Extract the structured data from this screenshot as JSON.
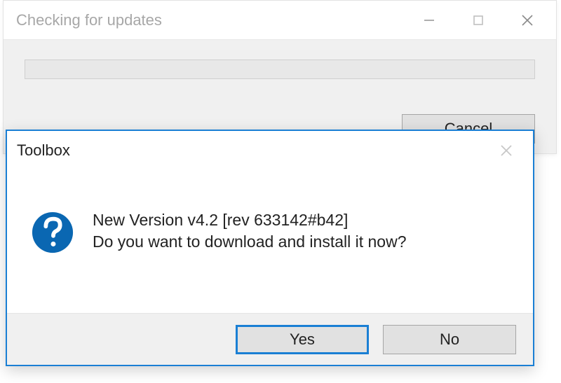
{
  "bgWindow": {
    "title": "Checking for updates",
    "cancelLabel": "Cancel"
  },
  "dialog": {
    "title": "Toolbox",
    "messageLine1": "New Version v4.2 [rev 633142#b42]",
    "messageLine2": "Do you want to download and install it now?",
    "yesLabel": "Yes",
    "noLabel": "No"
  }
}
